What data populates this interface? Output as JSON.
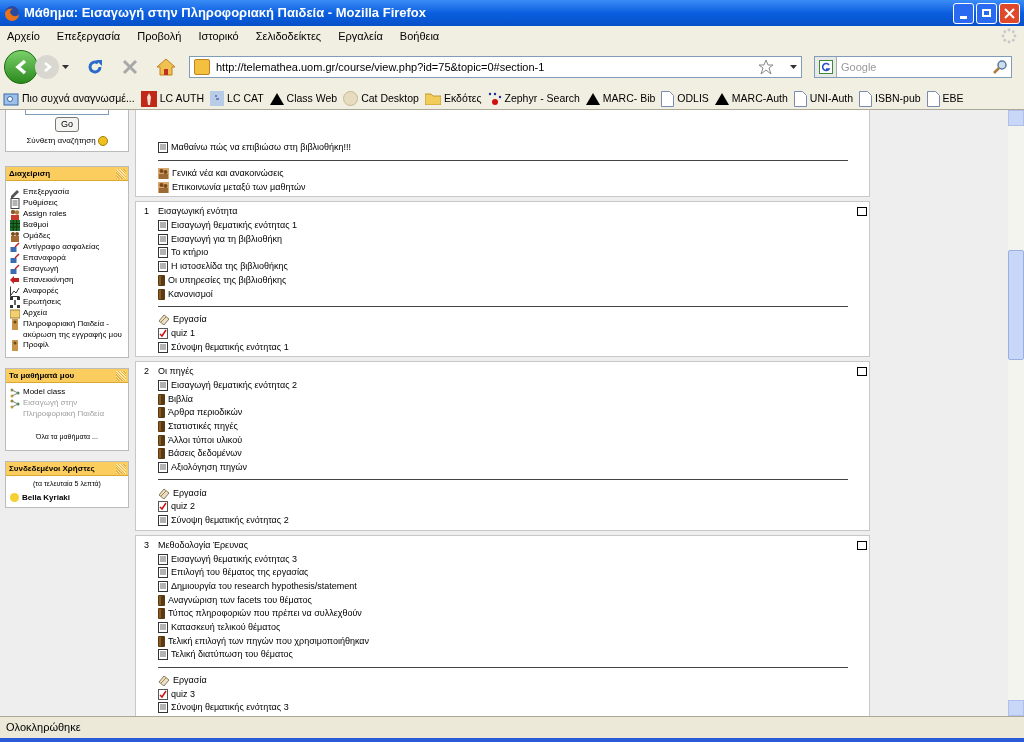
{
  "window": {
    "title": "Μάθημα: Εισαγωγή στην Πληροφοριακή Παιδεία - Mozilla Firefox"
  },
  "menu": [
    "Αρχείο",
    "Επεξεργασία",
    "Προβολή",
    "Ιστορικό",
    "Σελιδοδείκτες",
    "Εργαλεία",
    "Βοήθεια"
  ],
  "toolbar": {
    "url": "http://telemathea.uom.gr/course/view.php?id=75&topic=0#section-1",
    "search_placeholder": "Google"
  },
  "bookmarks": [
    {
      "label": "Πιο συχνά αναγνωσμέ...",
      "kind": "smart"
    },
    {
      "label": "LC AUTH",
      "kind": "red"
    },
    {
      "label": "LC CAT",
      "kind": "blue"
    },
    {
      "label": "Class Web",
      "kind": "triangle"
    },
    {
      "label": "Cat Desktop",
      "kind": "cat"
    },
    {
      "label": "Εκδότες",
      "kind": "folder"
    },
    {
      "label": "Zephyr - Search",
      "kind": "dots"
    },
    {
      "label": "MARC- Bib",
      "kind": "triangle"
    },
    {
      "label": "ODLIS",
      "kind": "page"
    },
    {
      "label": "MARC-Auth",
      "kind": "triangle"
    },
    {
      "label": "UNI-Auth",
      "kind": "page"
    },
    {
      "label": "ISBN-pub",
      "kind": "page"
    },
    {
      "label": "EBE",
      "kind": "page"
    }
  ],
  "sidebar": {
    "search": {
      "button": "Go",
      "advanced": "Σύνθετη αναζήτηση"
    },
    "admin": {
      "title": "Διαχείριση",
      "items": [
        {
          "label": "Επεξεργασία",
          "kind": "edit"
        },
        {
          "label": "Ρυθμίσεις",
          "kind": "settings"
        },
        {
          "label": "Assign roles",
          "kind": "roles"
        },
        {
          "label": "Βαθμοί",
          "kind": "grades"
        },
        {
          "label": "Ομάδες",
          "kind": "groups"
        },
        {
          "label": "Αντίγραφο ασφαλείας",
          "kind": "backup"
        },
        {
          "label": "Επαναφορά",
          "kind": "backup"
        },
        {
          "label": "Εισαγωγή",
          "kind": "backup"
        },
        {
          "label": "Επανεκκίνηση",
          "kind": "reset"
        },
        {
          "label": "Αναφορές",
          "kind": "reports"
        },
        {
          "label": "Ερωτήσεις",
          "kind": "questions"
        },
        {
          "label": "Αρχεία",
          "kind": "files"
        },
        {
          "label": "Πληροφοριακή Παιδεία - ακύρωση της εγγραφής μου",
          "kind": "user"
        },
        {
          "label": "Προφίλ",
          "kind": "user"
        }
      ]
    },
    "courses": {
      "title": "Τα μαθήματά μου",
      "items": [
        {
          "label": "Model class",
          "disabled": false
        },
        {
          "label": "Εισαγωγή στην Πληροφοριακή Παιδεία",
          "disabled": true
        }
      ],
      "all": "Όλα τα μαθήματα ..."
    },
    "online": {
      "title": "Συνδεδεμένοι Χρήστες",
      "subtitle": "(τα τελευταία 5 λεπτά)",
      "users": [
        "Bella Kyriaki"
      ]
    }
  },
  "sections": [
    {
      "resources": [
        {
          "label": "Μαθαίνω πώς να επιβιώσω στη βιβλιοθήκη!!!",
          "kind": "page"
        }
      ],
      "activities": [
        {
          "label": "Γενικά νέα και ανακοινώσεις",
          "kind": "forum"
        },
        {
          "label": "Επικοινωνία μεταξύ των μαθητών",
          "kind": "forum"
        }
      ]
    },
    {
      "number": "1",
      "title": "Εισαγωγική ενότητα",
      "resources": [
        {
          "label": "Εισαγωγή θεματικής ενότητας 1",
          "kind": "page"
        },
        {
          "label": "Εισαγωγή για τη βιβλιοθήκη",
          "kind": "page"
        },
        {
          "label": "Το κτήριο",
          "kind": "page"
        },
        {
          "label": "Η ιστοσελίδα της βιβλιοθήκης",
          "kind": "page"
        },
        {
          "label": "Οι υπηρεσίες της βιβλιοθήκης",
          "kind": "book"
        },
        {
          "label": "Κανονισμοί",
          "kind": "book"
        }
      ],
      "activities": [
        {
          "label": "Εργασία",
          "kind": "assignment"
        },
        {
          "label": "quiz 1",
          "kind": "quiz"
        },
        {
          "label": "Σύνοψη θεματικής ενότητας 1",
          "kind": "page"
        }
      ]
    },
    {
      "number": "2",
      "title": "Οι πηγές",
      "resources": [
        {
          "label": "Εισαγωγή θεματικής ενότητας 2",
          "kind": "page"
        },
        {
          "label": "Βιβλία",
          "kind": "book"
        },
        {
          "label": "Άρθρα περιοδικών",
          "kind": "book"
        },
        {
          "label": "Στατιστικές πηγές",
          "kind": "book"
        },
        {
          "label": "Άλλοι τύποι υλικού",
          "kind": "book"
        },
        {
          "label": "Βάσεις δεδομένων",
          "kind": "book"
        },
        {
          "label": "Αξιολόγηση πηγών",
          "kind": "page"
        }
      ],
      "activities": [
        {
          "label": "Εργασία",
          "kind": "assignment"
        },
        {
          "label": "quiz 2",
          "kind": "quiz"
        },
        {
          "label": "Σύνοψη θεματικής ενότητας 2",
          "kind": "page"
        }
      ]
    },
    {
      "number": "3",
      "title": "Μεθοδολογία Έρευνας",
      "resources": [
        {
          "label": "Εισαγωγή θεματικής ενότητας 3",
          "kind": "page"
        },
        {
          "label": "Επιλογή του θέματος της εργασίας",
          "kind": "page"
        },
        {
          "label": "Δημιουργία του research hypothesis/statement",
          "kind": "page"
        },
        {
          "label": "Αναγνώριση των facets του θέματος",
          "kind": "book"
        },
        {
          "label": "Τύπος πληροφοριών που πρέπει να συλλεχθούν",
          "kind": "book"
        },
        {
          "label": "Κατασκευή τελικού θέματος",
          "kind": "page"
        },
        {
          "label": "Τελική επιλογή των πηγών που χρησιμοποιήθηκαν",
          "kind": "book"
        },
        {
          "label": "Τελική διατύπωση του θέματος",
          "kind": "page"
        }
      ],
      "activities": [
        {
          "label": "Εργασία",
          "kind": "assignment"
        },
        {
          "label": "quiz 3",
          "kind": "quiz"
        },
        {
          "label": "Σύνοψη θεματικής ενότητας 3",
          "kind": "page"
        }
      ]
    }
  ],
  "status_bar": "Ολοκληρώθηκε"
}
